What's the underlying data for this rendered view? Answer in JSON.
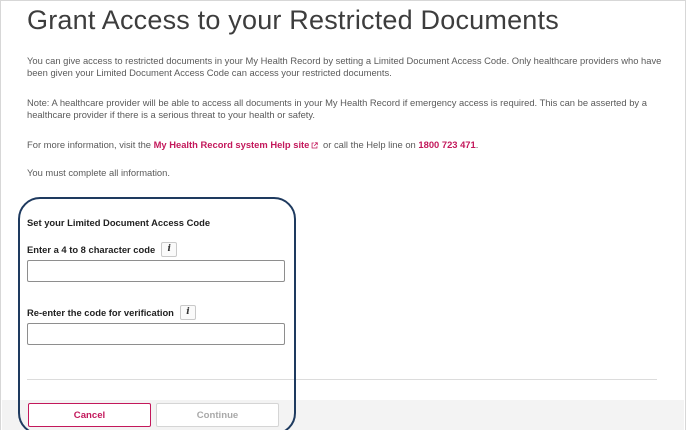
{
  "page": {
    "title": "Grant Access to your Restricted Documents",
    "intro": "You can give access to restricted documents in your My Health Record by setting a Limited Document Access Code. Only healthcare providers who have been given your Limited Document Access Code can access your restricted documents.",
    "note": "Note: A healthcare provider will be able to access all documents in your My Health Record if emergency access is required. This can be asserted by a healthcare provider if there is a serious threat to your health or safety.",
    "info_prefix": "For more information, visit the ",
    "help_link": "My Health Record system Help site",
    "info_middle": " or call the Help line on ",
    "phone": "1800 723 471",
    "info_suffix": ".",
    "required_note": "You must complete all information."
  },
  "form": {
    "section_title": "Set your Limited Document Access Code",
    "code_label": "Enter a 4 to 8 character code",
    "code_value": "",
    "reenter_label": "Re-enter the code for verification",
    "reenter_value": "",
    "info_glyph": "i"
  },
  "buttons": {
    "cancel": "Cancel",
    "continue": "Continue"
  },
  "icons": {
    "external_link": "external-link-icon",
    "info": "info-icon"
  },
  "colors": {
    "accent": "#c3185b",
    "highlight": "#1e3a5f",
    "disabled_text": "#a9a9a9"
  }
}
